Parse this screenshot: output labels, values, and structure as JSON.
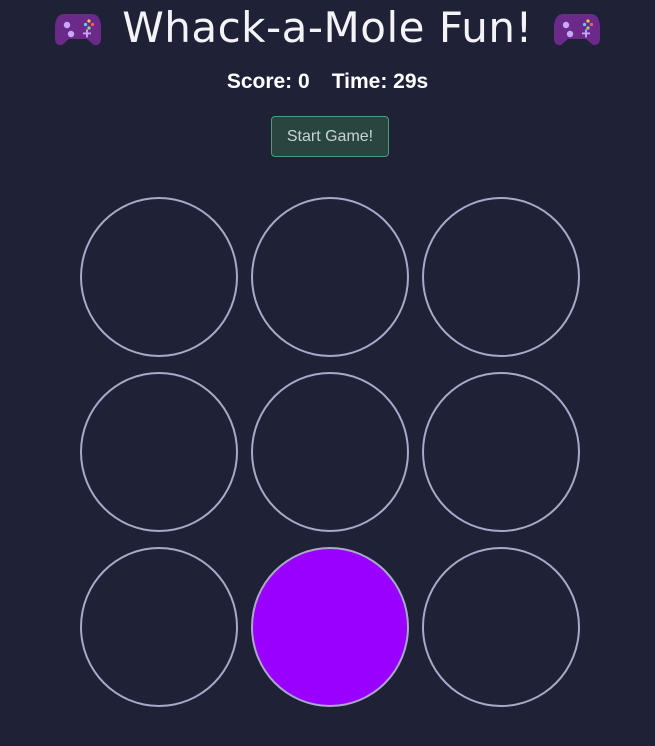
{
  "header": {
    "title": "Whack-a-Mole Fun!",
    "left_icon": "gamepad-icon",
    "right_icon": "gamepad-icon"
  },
  "stats": {
    "score_label": "Score: 0",
    "time_label": "Time: 29s"
  },
  "controls": {
    "start_label": "Start Game!"
  },
  "board": {
    "rows": 3,
    "cols": 3,
    "active_holes": [
      7
    ],
    "colors": {
      "background": "#1f2136",
      "hole_border": "#a9a8c8",
      "mole": "#9900ff",
      "button_bg": "#28453f",
      "button_border": "#4e9a7c"
    }
  }
}
